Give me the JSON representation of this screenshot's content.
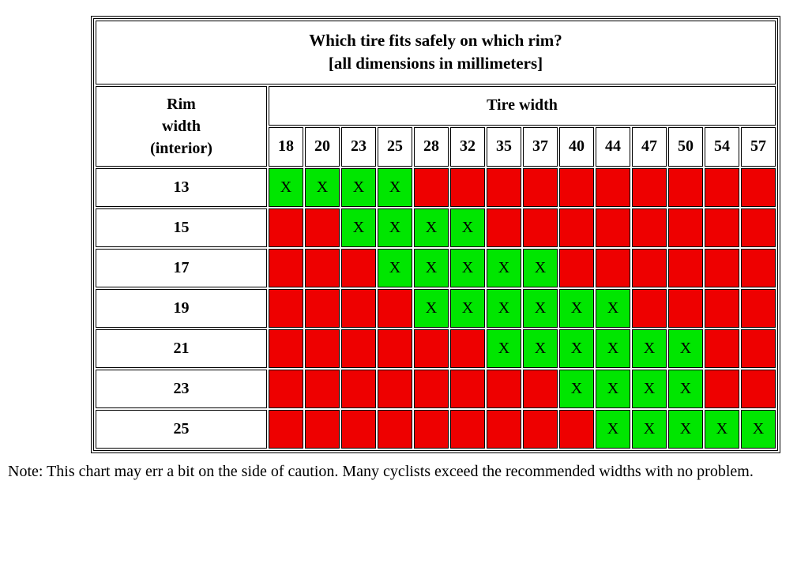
{
  "title_line1": "Which tire fits safely on which rim?",
  "title_line2": "[all dimensions in millimeters]",
  "section_header": "Tire width",
  "rim_header_line1": "Rim",
  "rim_header_line2": "width",
  "rim_header_line3": "(interior)",
  "tire_widths": [
    "18",
    "20",
    "23",
    "25",
    "28",
    "32",
    "35",
    "37",
    "40",
    "44",
    "47",
    "50",
    "54",
    "57"
  ],
  "rim_widths": [
    "13",
    "15",
    "17",
    "19",
    "21",
    "23",
    "25"
  ],
  "ok_mark": "X",
  "chart_data": {
    "type": "table",
    "title": "Which tire fits safely on which rim? [all dimensions in millimeters]",
    "columns_label": "Tire width",
    "rows_label": "Rim width (interior)",
    "columns": [
      18,
      20,
      23,
      25,
      28,
      32,
      35,
      37,
      40,
      44,
      47,
      50,
      54,
      57
    ],
    "rows": [
      13,
      15,
      17,
      19,
      21,
      23,
      25
    ],
    "ok_marker": "X",
    "grid": [
      [
        true,
        true,
        true,
        true,
        false,
        false,
        false,
        false,
        false,
        false,
        false,
        false,
        false,
        false
      ],
      [
        false,
        false,
        true,
        true,
        true,
        true,
        false,
        false,
        false,
        false,
        false,
        false,
        false,
        false
      ],
      [
        false,
        false,
        false,
        true,
        true,
        true,
        true,
        true,
        false,
        false,
        false,
        false,
        false,
        false
      ],
      [
        false,
        false,
        false,
        false,
        true,
        true,
        true,
        true,
        true,
        true,
        false,
        false,
        false,
        false
      ],
      [
        false,
        false,
        false,
        false,
        false,
        false,
        true,
        true,
        true,
        true,
        true,
        true,
        false,
        false
      ],
      [
        false,
        false,
        false,
        false,
        false,
        false,
        false,
        false,
        true,
        true,
        true,
        true,
        false,
        false
      ],
      [
        false,
        false,
        false,
        false,
        false,
        false,
        false,
        false,
        false,
        true,
        true,
        true,
        true,
        true
      ]
    ]
  },
  "note": "Note: This chart may err a bit on the side of caution. Many cyclists exceed the recommended widths with no problem."
}
